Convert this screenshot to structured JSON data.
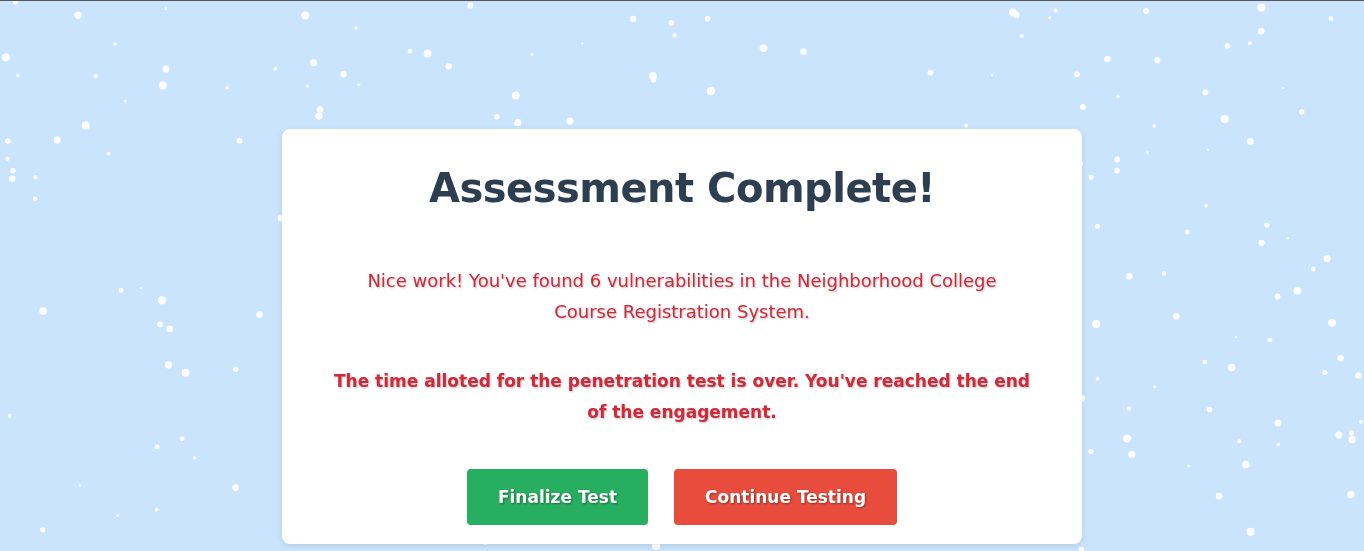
{
  "dialog": {
    "title": "Assessment Complete!",
    "message": "Nice work! You've found 6 vulnerabilities in the Neighborhood College Course Registration System.",
    "notice": "The time alloted for the penetration test is over. You've reached the end of the engagement.",
    "buttons": [
      {
        "label": "Finalize Test",
        "kind": "confirm"
      },
      {
        "label": "Continue Testing",
        "kind": "danger"
      }
    ]
  }
}
